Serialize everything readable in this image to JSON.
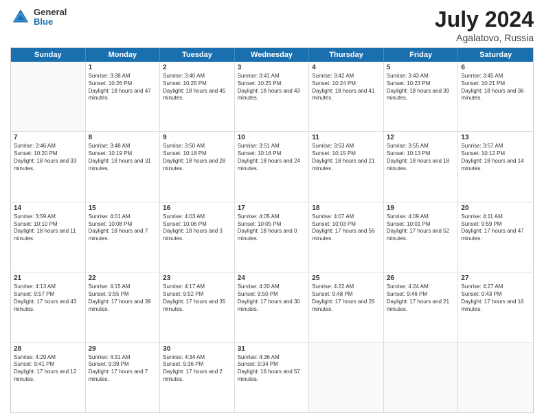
{
  "header": {
    "logo_line1": "General",
    "logo_line2": "Blue",
    "month_year": "July 2024",
    "location": "Agalatovo, Russia"
  },
  "days_of_week": [
    "Sunday",
    "Monday",
    "Tuesday",
    "Wednesday",
    "Thursday",
    "Friday",
    "Saturday"
  ],
  "rows": [
    [
      {
        "day": "",
        "sunrise": "",
        "sunset": "",
        "daylight": "",
        "empty": true
      },
      {
        "day": "1",
        "sunrise": "Sunrise: 3:38 AM",
        "sunset": "Sunset: 10:26 PM",
        "daylight": "Daylight: 18 hours and 47 minutes."
      },
      {
        "day": "2",
        "sunrise": "Sunrise: 3:40 AM",
        "sunset": "Sunset: 10:25 PM",
        "daylight": "Daylight: 18 hours and 45 minutes."
      },
      {
        "day": "3",
        "sunrise": "Sunrise: 3:41 AM",
        "sunset": "Sunset: 10:25 PM",
        "daylight": "Daylight: 18 hours and 43 minutes."
      },
      {
        "day": "4",
        "sunrise": "Sunrise: 3:42 AM",
        "sunset": "Sunset: 10:24 PM",
        "daylight": "Daylight: 18 hours and 41 minutes."
      },
      {
        "day": "5",
        "sunrise": "Sunrise: 3:43 AM",
        "sunset": "Sunset: 10:23 PM",
        "daylight": "Daylight: 18 hours and 39 minutes."
      },
      {
        "day": "6",
        "sunrise": "Sunrise: 3:45 AM",
        "sunset": "Sunset: 10:21 PM",
        "daylight": "Daylight: 18 hours and 36 minutes."
      }
    ],
    [
      {
        "day": "7",
        "sunrise": "Sunrise: 3:46 AM",
        "sunset": "Sunset: 10:20 PM",
        "daylight": "Daylight: 18 hours and 33 minutes."
      },
      {
        "day": "8",
        "sunrise": "Sunrise: 3:48 AM",
        "sunset": "Sunset: 10:19 PM",
        "daylight": "Daylight: 18 hours and 31 minutes."
      },
      {
        "day": "9",
        "sunrise": "Sunrise: 3:50 AM",
        "sunset": "Sunset: 10:18 PM",
        "daylight": "Daylight: 18 hours and 28 minutes."
      },
      {
        "day": "10",
        "sunrise": "Sunrise: 3:51 AM",
        "sunset": "Sunset: 10:16 PM",
        "daylight": "Daylight: 18 hours and 24 minutes."
      },
      {
        "day": "11",
        "sunrise": "Sunrise: 3:53 AM",
        "sunset": "Sunset: 10:15 PM",
        "daylight": "Daylight: 18 hours and 21 minutes."
      },
      {
        "day": "12",
        "sunrise": "Sunrise: 3:55 AM",
        "sunset": "Sunset: 10:13 PM",
        "daylight": "Daylight: 18 hours and 18 minutes."
      },
      {
        "day": "13",
        "sunrise": "Sunrise: 3:57 AM",
        "sunset": "Sunset: 10:12 PM",
        "daylight": "Daylight: 18 hours and 14 minutes."
      }
    ],
    [
      {
        "day": "14",
        "sunrise": "Sunrise: 3:59 AM",
        "sunset": "Sunset: 10:10 PM",
        "daylight": "Daylight: 18 hours and 11 minutes."
      },
      {
        "day": "15",
        "sunrise": "Sunrise: 4:01 AM",
        "sunset": "Sunset: 10:08 PM",
        "daylight": "Daylight: 18 hours and 7 minutes."
      },
      {
        "day": "16",
        "sunrise": "Sunrise: 4:03 AM",
        "sunset": "Sunset: 10:06 PM",
        "daylight": "Daylight: 18 hours and 3 minutes."
      },
      {
        "day": "17",
        "sunrise": "Sunrise: 4:05 AM",
        "sunset": "Sunset: 10:05 PM",
        "daylight": "Daylight: 18 hours and 0 minutes."
      },
      {
        "day": "18",
        "sunrise": "Sunrise: 4:07 AM",
        "sunset": "Sunset: 10:03 PM",
        "daylight": "Daylight: 17 hours and 56 minutes."
      },
      {
        "day": "19",
        "sunrise": "Sunrise: 4:09 AM",
        "sunset": "Sunset: 10:01 PM",
        "daylight": "Daylight: 17 hours and 52 minutes."
      },
      {
        "day": "20",
        "sunrise": "Sunrise: 4:11 AM",
        "sunset": "Sunset: 9:59 PM",
        "daylight": "Daylight: 17 hours and 47 minutes."
      }
    ],
    [
      {
        "day": "21",
        "sunrise": "Sunrise: 4:13 AM",
        "sunset": "Sunset: 9:57 PM",
        "daylight": "Daylight: 17 hours and 43 minutes."
      },
      {
        "day": "22",
        "sunrise": "Sunrise: 4:15 AM",
        "sunset": "Sunset: 9:55 PM",
        "daylight": "Daylight: 17 hours and 39 minutes."
      },
      {
        "day": "23",
        "sunrise": "Sunrise: 4:17 AM",
        "sunset": "Sunset: 9:52 PM",
        "daylight": "Daylight: 17 hours and 35 minutes."
      },
      {
        "day": "24",
        "sunrise": "Sunrise: 4:20 AM",
        "sunset": "Sunset: 9:50 PM",
        "daylight": "Daylight: 17 hours and 30 minutes."
      },
      {
        "day": "25",
        "sunrise": "Sunrise: 4:22 AM",
        "sunset": "Sunset: 9:48 PM",
        "daylight": "Daylight: 17 hours and 26 minutes."
      },
      {
        "day": "26",
        "sunrise": "Sunrise: 4:24 AM",
        "sunset": "Sunset: 9:46 PM",
        "daylight": "Daylight: 17 hours and 21 minutes."
      },
      {
        "day": "27",
        "sunrise": "Sunrise: 4:27 AM",
        "sunset": "Sunset: 9:43 PM",
        "daylight": "Daylight: 17 hours and 16 minutes."
      }
    ],
    [
      {
        "day": "28",
        "sunrise": "Sunrise: 4:29 AM",
        "sunset": "Sunset: 9:41 PM",
        "daylight": "Daylight: 17 hours and 12 minutes."
      },
      {
        "day": "29",
        "sunrise": "Sunrise: 4:31 AM",
        "sunset": "Sunset: 9:39 PM",
        "daylight": "Daylight: 17 hours and 7 minutes."
      },
      {
        "day": "30",
        "sunrise": "Sunrise: 4:34 AM",
        "sunset": "Sunset: 9:36 PM",
        "daylight": "Daylight: 17 hours and 2 minutes."
      },
      {
        "day": "31",
        "sunrise": "Sunrise: 4:36 AM",
        "sunset": "Sunset: 9:34 PM",
        "daylight": "Daylight: 16 hours and 57 minutes."
      },
      {
        "day": "",
        "sunrise": "",
        "sunset": "",
        "daylight": "",
        "empty": true
      },
      {
        "day": "",
        "sunrise": "",
        "sunset": "",
        "daylight": "",
        "empty": true
      },
      {
        "day": "",
        "sunrise": "",
        "sunset": "",
        "daylight": "",
        "empty": true
      }
    ]
  ]
}
